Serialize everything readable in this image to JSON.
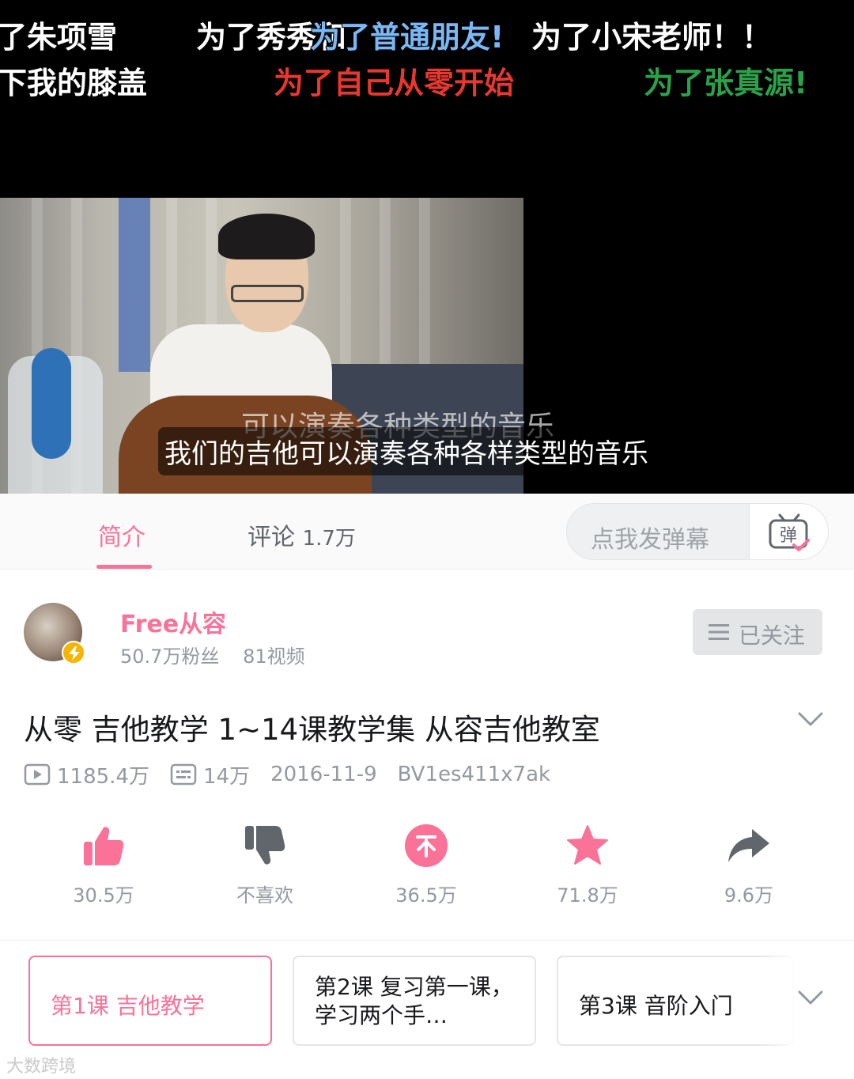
{
  "player": {
    "danmaku": [
      {
        "text": "了朱项雪",
        "color": "#ffffff"
      },
      {
        "text": "为了秀秀和",
        "color": "#ffffff"
      },
      {
        "text": "为了普通朋友!",
        "color": "#7ab8f5"
      },
      {
        "text": "为了小宋老师！！",
        "color": "#ffffff"
      },
      {
        "text": "下我的膝盖",
        "color": "#ffffff"
      },
      {
        "text": "为了自己从零开始",
        "color": "#e8372e"
      },
      {
        "text": "为了张真源!",
        "color": "#2aa24a"
      }
    ],
    "subtitle_shadow": "可以演奏各种类型的音乐",
    "subtitle": "我们的吉他可以演奏各种各样类型的音乐"
  },
  "tabs": {
    "intro": "简介",
    "comments": "评论",
    "comments_count": "1.7万",
    "danmaku_placeholder": "点我发弹幕",
    "danmaku_button_icon": "bullet-comment-icon"
  },
  "uploader": {
    "name": "Free从容",
    "fans": "50.7万粉丝",
    "videos": "81视频",
    "follow_label": "已关注"
  },
  "video": {
    "title": "从零 吉他教学 1~14课教学集 从容吉他教室",
    "plays": "1185.4万",
    "danmaku_count": "14万",
    "date": "2016-11-9",
    "bvid": "BV1es411x7ak"
  },
  "actions": {
    "like": "30.5万",
    "dislike": "不喜欢",
    "coin": "36.5万",
    "favorite": "71.8万",
    "share": "9.6万"
  },
  "episodes": [
    {
      "title": "第1课 吉他教学"
    },
    {
      "title": "第2课 复习第一课，学习两个手…"
    },
    {
      "title": "第3课 音阶入门"
    }
  ],
  "watermark": "大数跨境",
  "colors": {
    "accent": "#fb7299",
    "muted": "#9499a0"
  }
}
